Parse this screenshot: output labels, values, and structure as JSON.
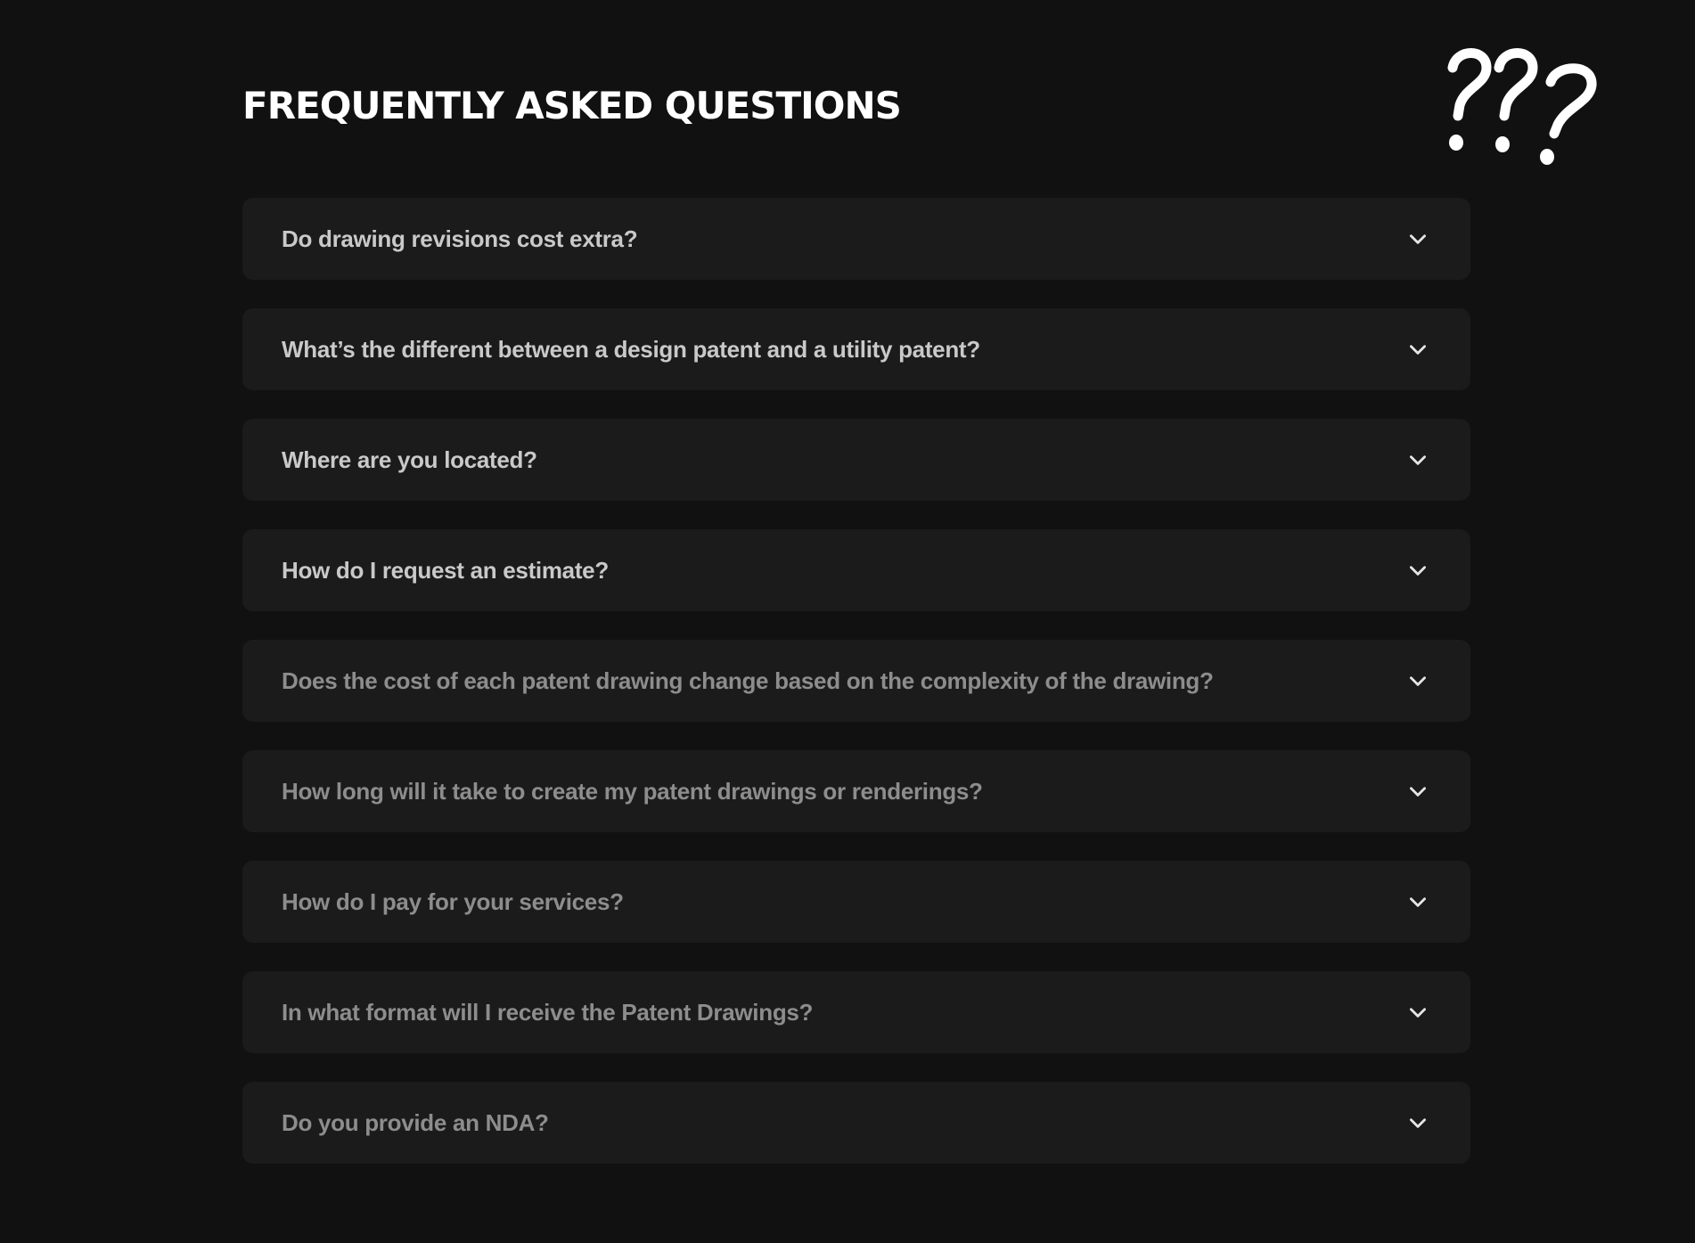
{
  "faq": {
    "title": "FREQUENTLY ASKED QUESTIONS",
    "decoration_icon": "question-marks-icon",
    "expand_icon": "chevron-down-icon",
    "items": [
      {
        "question": "Do drawing revisions cost extra?",
        "expanded": false
      },
      {
        "question": "What’s the different between a design patent and a utility patent?",
        "expanded": false
      },
      {
        "question": "Where are you located?",
        "expanded": false
      },
      {
        "question": "How do I request an estimate?",
        "expanded": false
      },
      {
        "question": "Does the cost of each patent drawing change based on the complexity of the drawing?",
        "expanded": false
      },
      {
        "question": "How long will it take to create my patent drawings or renderings?",
        "expanded": false
      },
      {
        "question": "How do I pay for your services?",
        "expanded": false
      },
      {
        "question": "In what format will I receive the Patent Drawings?",
        "expanded": false
      },
      {
        "question": "Do you provide an NDA?",
        "expanded": false
      }
    ]
  },
  "colors": {
    "background": "#111111",
    "card": "#1b1b1c",
    "title": "#ffffff",
    "question_bright": "#c9c9c9",
    "question_dim": "#8d8d8d",
    "chevron": "#e6e6e6"
  }
}
